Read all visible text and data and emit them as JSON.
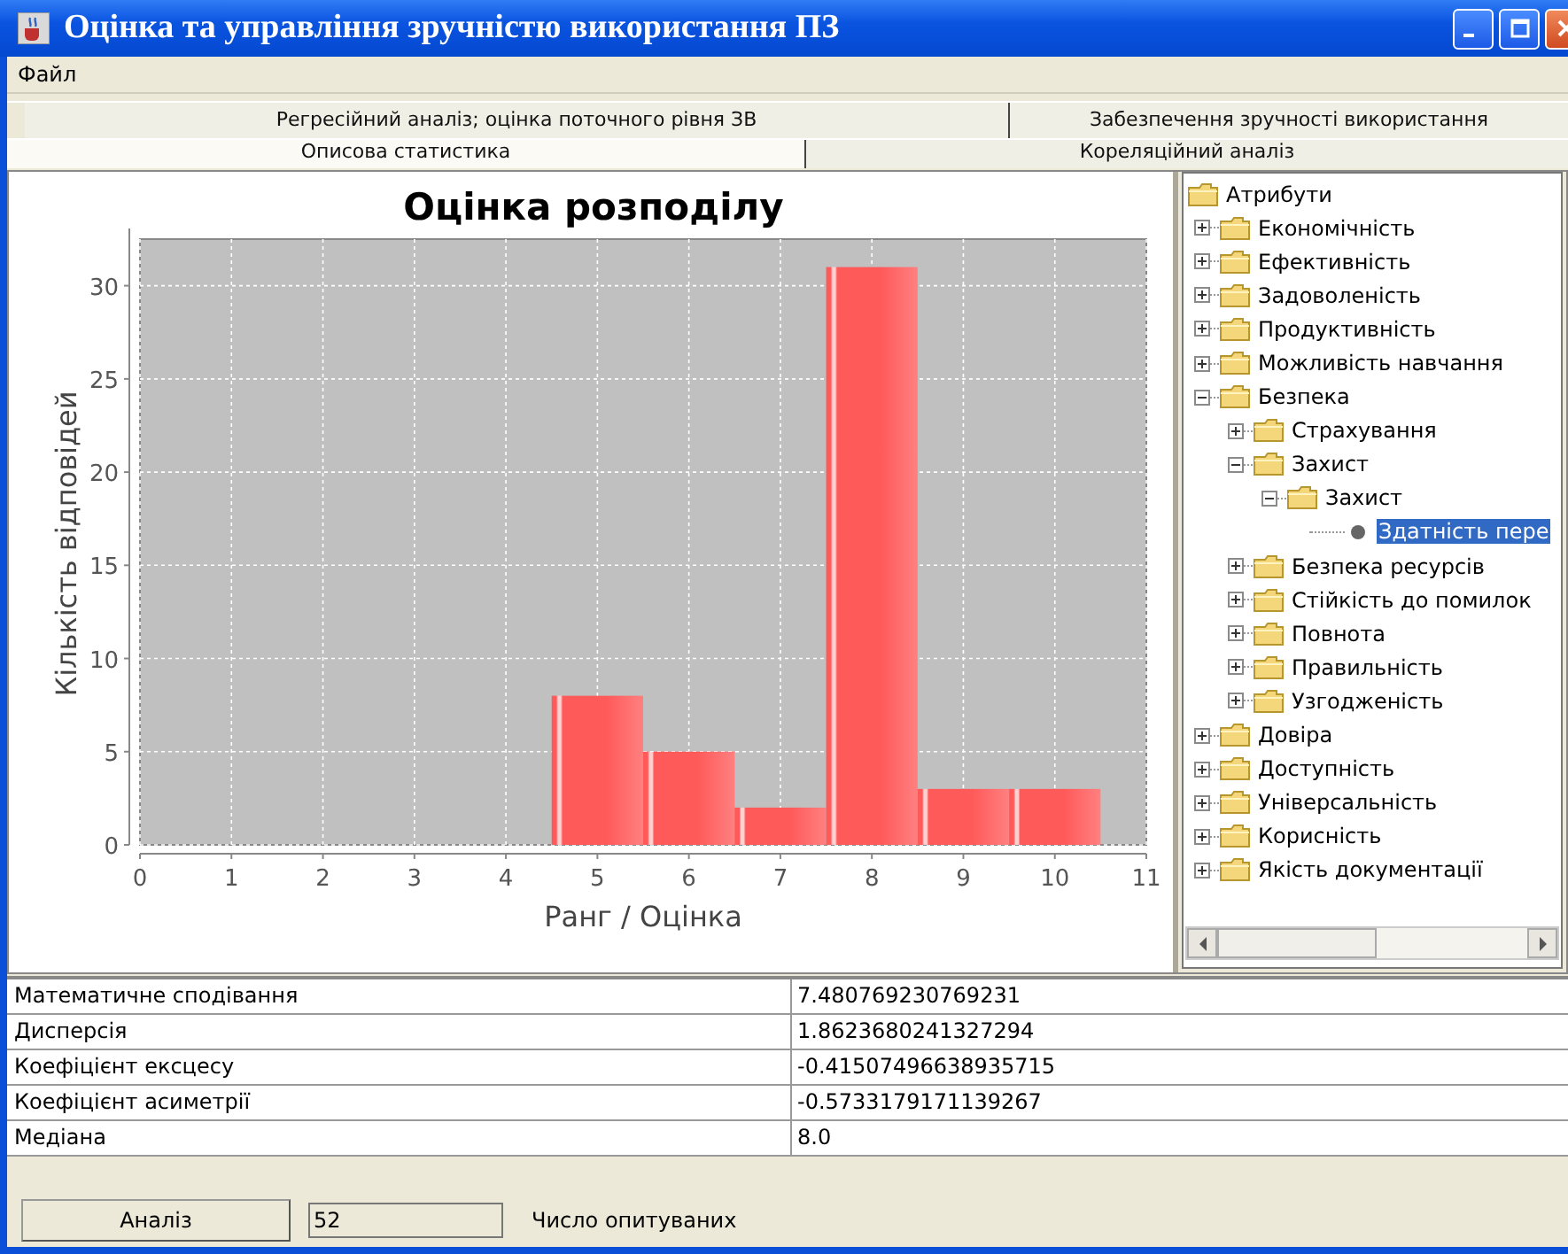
{
  "window": {
    "title": "Оцінка та управління зручністю використання ПЗ"
  },
  "menu": [
    "Файл"
  ],
  "tab_rows": [
    [
      {
        "label": "Регресійний аналіз; оцінка поточного рівня ЗВ",
        "selected": false
      },
      {
        "label": "Забезпечення зручності використання",
        "selected": false
      }
    ],
    [
      {
        "label": "Описова статистика",
        "selected": true
      },
      {
        "label": "Кореляційний аналіз",
        "selected": false
      }
    ]
  ],
  "chart": {
    "chart_data": {
      "type": "bar",
      "title": "Оцінка розподілу",
      "xlabel": "Ранг / Оцінка",
      "ylabel": "Кількість відповідей",
      "x": [
        5,
        6,
        7,
        8,
        9,
        10
      ],
      "values": [
        8,
        5,
        2,
        31,
        3,
        3
      ],
      "xlim": [
        0,
        11
      ],
      "ylim": [
        0,
        32.5
      ],
      "xticks": [
        0,
        1,
        2,
        3,
        4,
        5,
        6,
        7,
        8,
        9,
        10,
        11
      ],
      "yticks": [
        0,
        5,
        10,
        15,
        20,
        25,
        30
      ],
      "grid": true
    }
  },
  "tree": {
    "label": "Атрибути",
    "kind": "folder",
    "expanded": true,
    "selected": false,
    "children": [
      {
        "label": "Економічність",
        "kind": "folder",
        "expanded": false,
        "selected": false
      },
      {
        "label": "Ефективність",
        "kind": "folder",
        "expanded": false,
        "selected": false
      },
      {
        "label": "Задоволеність",
        "kind": "folder",
        "expanded": false,
        "selected": false
      },
      {
        "label": "Продуктивність",
        "kind": "folder",
        "expanded": false,
        "selected": false
      },
      {
        "label": "Можливість навчання",
        "kind": "folder",
        "expanded": false,
        "selected": false
      },
      {
        "label": "Безпека",
        "kind": "folder",
        "expanded": true,
        "selected": false,
        "children": [
          {
            "label": "Страхування",
            "kind": "folder",
            "expanded": false,
            "selected": false
          },
          {
            "label": "Захист",
            "kind": "folder",
            "expanded": true,
            "selected": false,
            "children": [
              {
                "label": "Захист",
                "kind": "folder",
                "expanded": true,
                "selected": false,
                "children": [
                  {
                    "label": "Здатність пере",
                    "kind": "leaf",
                    "selected": true
                  }
                ]
              }
            ]
          },
          {
            "label": "Безпека ресурсів",
            "kind": "folder",
            "expanded": false,
            "selected": false
          },
          {
            "label": "Стійкість до помилок",
            "kind": "folder",
            "expanded": false,
            "selected": false
          },
          {
            "label": "Повнота",
            "kind": "folder",
            "expanded": false,
            "selected": false
          },
          {
            "label": "Правильність",
            "kind": "folder",
            "expanded": false,
            "selected": false
          },
          {
            "label": "Узгодженість",
            "kind": "folder",
            "expanded": false,
            "selected": false
          }
        ]
      },
      {
        "label": "Довіра",
        "kind": "folder",
        "expanded": false,
        "selected": false
      },
      {
        "label": "Доступність",
        "kind": "folder",
        "expanded": false,
        "selected": false
      },
      {
        "label": "Універсальність",
        "kind": "folder",
        "expanded": false,
        "selected": false
      },
      {
        "label": "Корисність",
        "kind": "folder",
        "expanded": false,
        "selected": false
      },
      {
        "label": "Якість документації",
        "kind": "folder",
        "expanded": false,
        "selected": false
      }
    ]
  },
  "stats": [
    {
      "name": "Математичне сподівання",
      "value": "7.480769230769231"
    },
    {
      "name": "Дисперсія",
      "value": "1.8623680241327294"
    },
    {
      "name": "Коефіцієнт ексцесу",
      "value": "-0.41507496638935715"
    },
    {
      "name": "Коефіцієнт асиметрії",
      "value": "-0.5733179171139267"
    },
    {
      "name": "Медіана",
      "value": "8.0"
    }
  ],
  "bottom": {
    "button": "Аналіз",
    "count": "52",
    "count_label": "Число опитуваних"
  }
}
